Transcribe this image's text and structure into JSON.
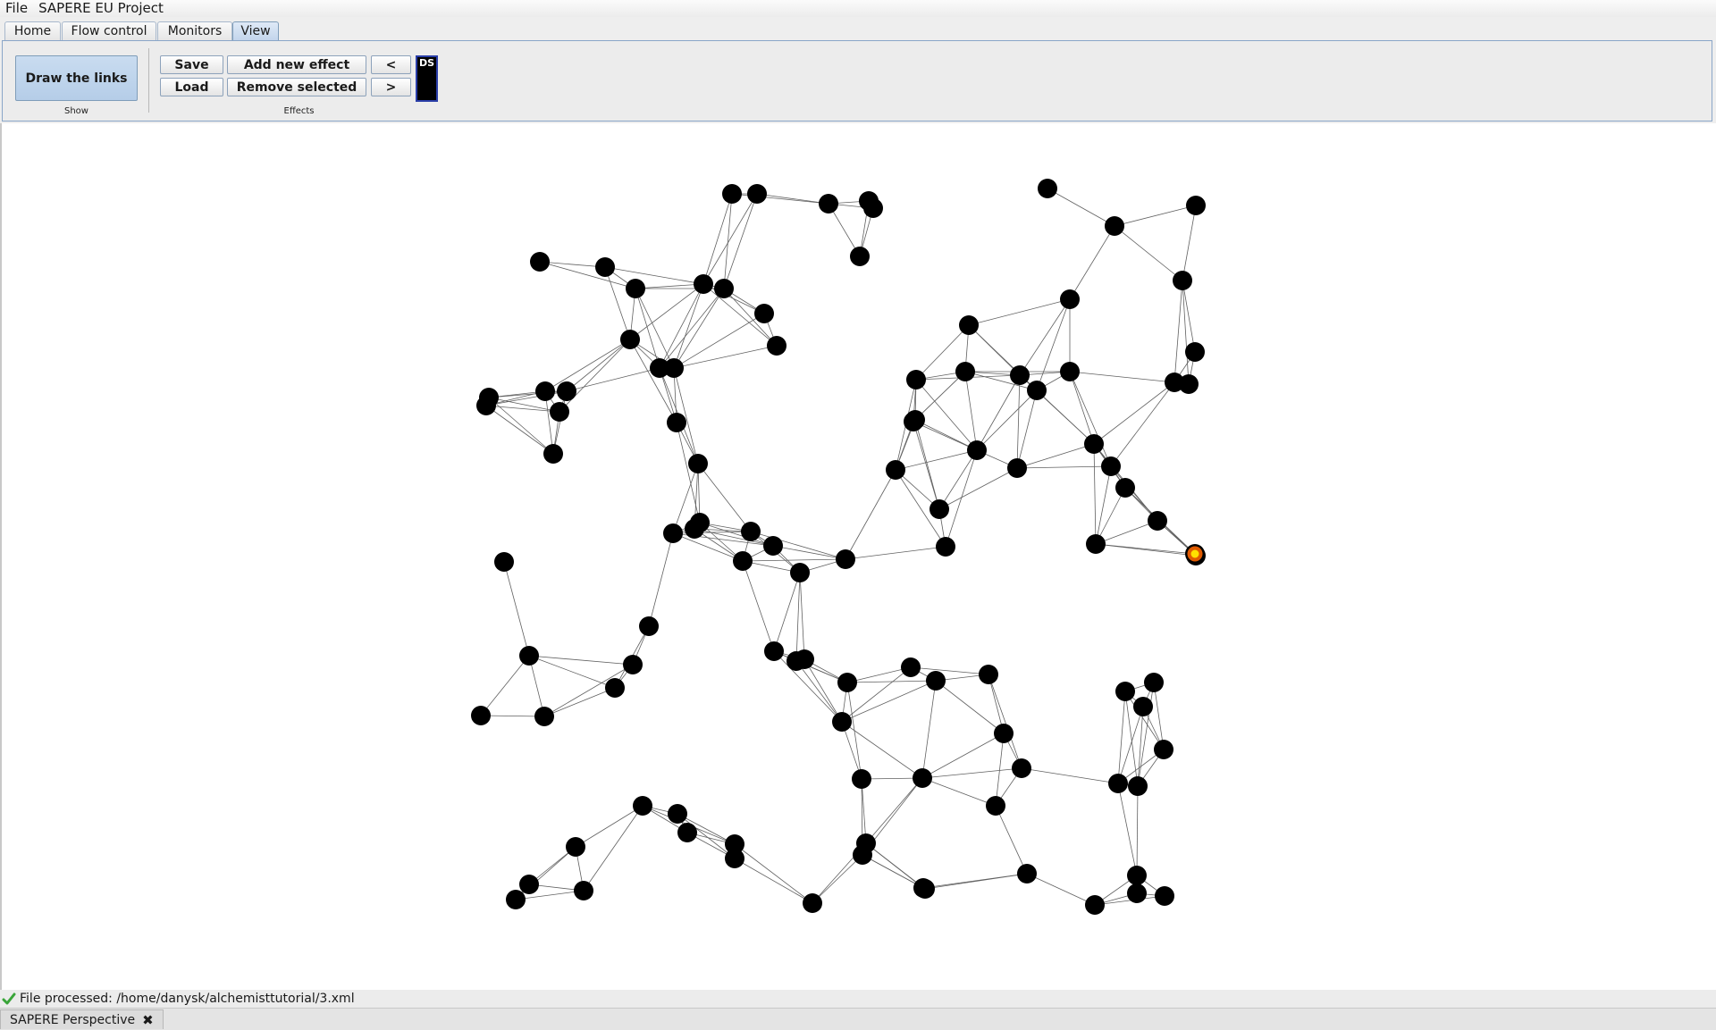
{
  "menubar": {
    "items": [
      "File",
      "SAPERE EU Project"
    ]
  },
  "tabs": [
    "Home",
    "Flow control",
    "Monitors",
    "View"
  ],
  "active_tab": "View",
  "ribbon": {
    "show_group": {
      "draw_links_label": "Draw the links",
      "label": "Show"
    },
    "effects_group": {
      "save_label": "Save",
      "load_label": "Load",
      "add_effect_label": "Add new effect",
      "remove_selected_label": "Remove selected",
      "prev_label": "<",
      "next_label": ">",
      "label": "Effects",
      "ds_label": "DS"
    }
  },
  "graph": {
    "node_color": "#000000",
    "edge_color": "#606060",
    "highlight_outer_color": "#e05a00",
    "highlight_inner_color": "#ffe000"
  },
  "status": {
    "text": "File processed: /home/danysk/alchemisttutorial/3.xml",
    "icon": "check-icon"
  },
  "perspective": {
    "tab_label": "SAPERE Perspective",
    "close_icon": "close-icon"
  }
}
